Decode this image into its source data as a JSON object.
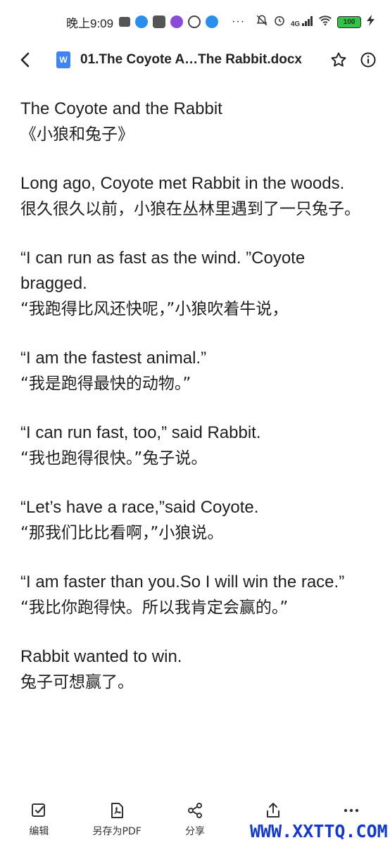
{
  "status_bar": {
    "time": "晚上9:09",
    "more": "···",
    "signal": "4G",
    "battery": "100"
  },
  "header": {
    "back_icon": "chevron-left-icon",
    "doc_badge": "W",
    "title": "01.The Coyote A…The Rabbit.docx",
    "star_icon": "star-icon",
    "info_icon": "info-icon"
  },
  "document": {
    "paragraphs": [
      {
        "en": "The Coyote and the Rabbit",
        "zh": "《小狼和兔子》"
      },
      {
        "en": "Long ago, Coyote met Rabbit in the woods.",
        "zh": "很久很久以前，小狼在丛林里遇到了一只兔子。"
      },
      {
        "en": "“I can run as fast as the wind. ”Coyote bragged.",
        "zh": "“我跑得比风还快呢，”小狼吹着牛说，"
      },
      {
        "en": "“I am the fastest animal.”",
        "zh": "“我是跑得最快的动物。”"
      },
      {
        "en": "“I can run fast, too,” said Rabbit.",
        "zh": "“我也跑得很快。”兔子说。"
      },
      {
        "en": "“Let’s have a race,”said Coyote.",
        "zh": "“那我们比比看啊，”小狼说。"
      },
      {
        "en": "“I am faster than you.So I will win the race.”",
        "zh": "“我比你跑得快。所以我肯定会赢的。”"
      },
      {
        "en": "Rabbit wanted to win.",
        "zh": "兔子可想赢了。"
      }
    ]
  },
  "toolbar": {
    "edit_label": "编辑",
    "save_pdf_label": "另存为PDF",
    "share_label": "分享",
    "export_label": "",
    "more_label": ""
  },
  "watermark": "WWW.XXTTQ.COM"
}
